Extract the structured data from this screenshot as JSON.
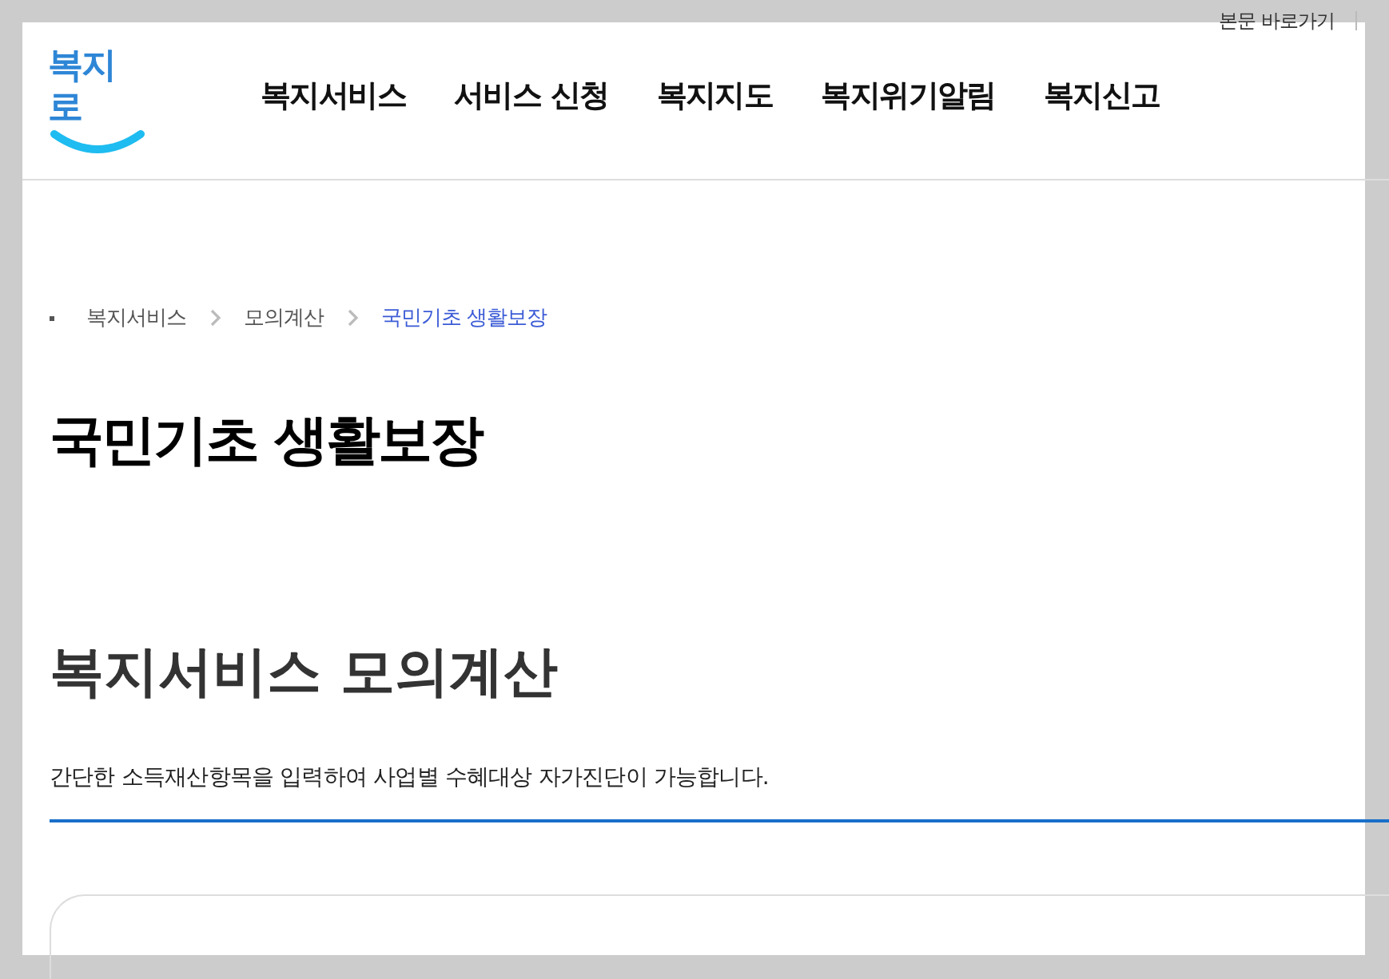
{
  "utility_links": [
    "본문 바로가기"
  ],
  "logo": {
    "text": "복지로"
  },
  "nav": [
    "복지서비스",
    "서비스 신청",
    "복지지도",
    "복지위기알림",
    "복지신고"
  ],
  "breadcrumb": [
    {
      "label": "복지서비스",
      "current": false
    },
    {
      "label": "모의계산",
      "current": false
    },
    {
      "label": "국민기초 생활보장",
      "current": true
    }
  ],
  "page_title": "국민기초 생활보장",
  "section": {
    "title": "복지서비스 모의계산",
    "description": "간단한 소득재산항목을 입력하여 사업별 수혜대상 자가진단이 가능합니다."
  }
}
